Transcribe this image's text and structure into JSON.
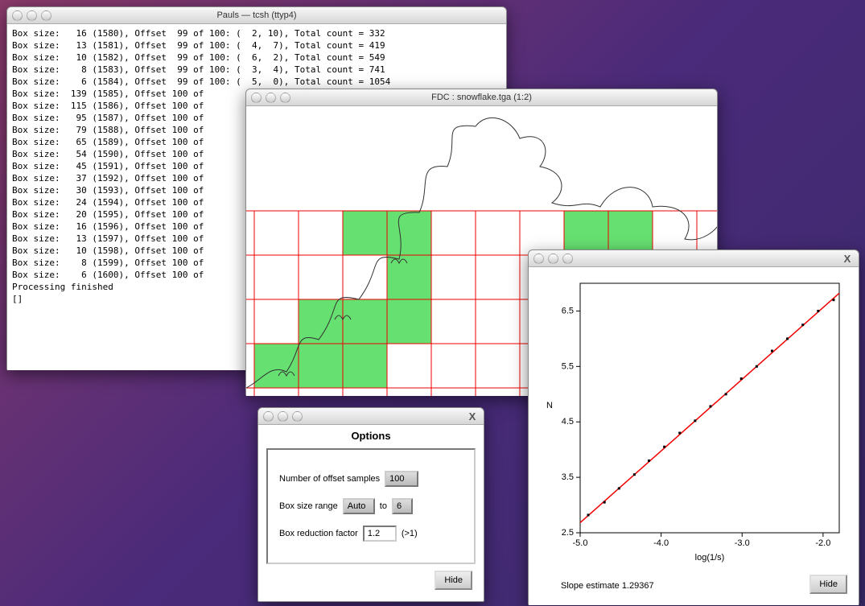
{
  "terminal": {
    "title": "Pauls — tcsh (ttyp4)",
    "lines": [
      "Box size:   16 (1580), Offset  99 of 100: (  2, 10), Total count = 332",
      "Box size:   13 (1581), Offset  99 of 100: (  4,  7), Total count = 419",
      "Box size:   10 (1582), Offset  99 of 100: (  6,  2), Total count = 549",
      "Box size:    8 (1583), Offset  99 of 100: (  3,  4), Total count = 741",
      "Box size:    6 (1584), Offset  99 of 100: (  5,  0), Total count = 1054",
      "Box size:  139 (1585), Offset 100 of",
      "Box size:  115 (1586), Offset 100 of",
      "Box size:   95 (1587), Offset 100 of",
      "Box size:   79 (1588), Offset 100 of",
      "Box size:   65 (1589), Offset 100 of",
      "Box size:   54 (1590), Offset 100 of",
      "Box size:   45 (1591), Offset 100 of",
      "Box size:   37 (1592), Offset 100 of",
      "Box size:   30 (1593), Offset 100 of",
      "Box size:   24 (1594), Offset 100 of",
      "Box size:   20 (1595), Offset 100 of",
      "Box size:   16 (1596), Offset 100 of",
      "Box size:   13 (1597), Offset 100 of",
      "Box size:   10 (1598), Offset 100 of",
      "Box size:    8 (1599), Offset 100 of",
      "Box size:    6 (1600), Offset 100 of",
      "Processing finished",
      "[]"
    ]
  },
  "fdc": {
    "title": "FDC : snowflake.tga (1:2)"
  },
  "options": {
    "heading": "Options",
    "offset_samples_label": "Number of offset samples",
    "offset_samples_value": "100",
    "box_size_range_label": "Box size range",
    "box_size_range_from": "Auto",
    "box_size_to_label": "to",
    "box_size_range_to": "6",
    "box_reduction_label": "Box reduction factor",
    "box_reduction_value": "1.2",
    "box_reduction_hint": "(>1)",
    "hide_label": "Hide"
  },
  "chart": {
    "slope_label": "Slope estimate  1.29367",
    "hide_label": "Hide",
    "chart_data": {
      "type": "scatter",
      "title": "",
      "xlabel": "log(1/s)",
      "ylabel": "N",
      "xlim": [
        -5.0,
        -1.8
      ],
      "ylim": [
        2.5,
        7.0
      ],
      "xticks": [
        -5.0,
        -4.0,
        -3.0,
        -2.0
      ],
      "yticks": [
        2.5,
        3.5,
        4.5,
        5.5,
        6.5
      ],
      "series": [
        {
          "name": "points",
          "x": [
            -4.9,
            -4.7,
            -4.52,
            -4.33,
            -4.15,
            -3.96,
            -3.77,
            -3.58,
            -3.39,
            -3.2,
            -3.01,
            -2.82,
            -2.63,
            -2.44,
            -2.25,
            -2.06,
            -1.87
          ],
          "y": [
            2.82,
            3.05,
            3.3,
            3.55,
            3.8,
            4.05,
            4.3,
            4.52,
            4.78,
            5.0,
            5.28,
            5.5,
            5.78,
            6.0,
            6.25,
            6.5,
            6.7
          ]
        }
      ],
      "fit": {
        "slope": 1.29367,
        "intercept": 9.15
      }
    }
  }
}
